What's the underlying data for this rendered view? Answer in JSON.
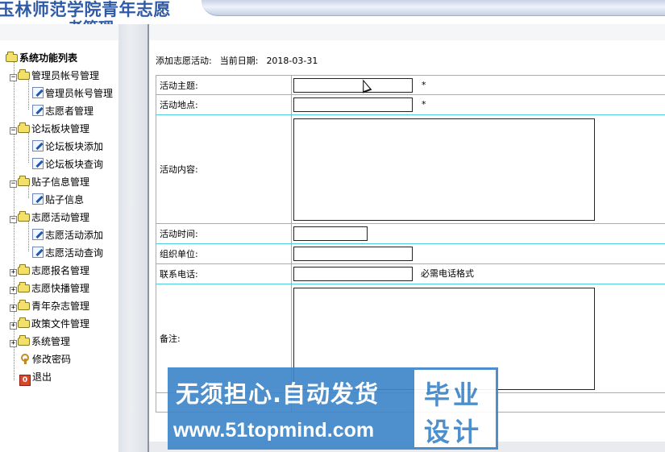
{
  "header": {
    "title": "玉林师范学院青年志愿",
    "title_line2": "者管理"
  },
  "sidebar": {
    "root_label": "系统功能列表",
    "groups": [
      {
        "label": "管理员帐号管理",
        "expanded": true,
        "items": [
          "管理员帐号管理",
          "志愿者管理"
        ]
      },
      {
        "label": "论坛板块管理",
        "expanded": true,
        "items": [
          "论坛板块添加",
          "论坛板块查询"
        ]
      },
      {
        "label": "贴子信息管理",
        "expanded": true,
        "items": [
          "贴子信息"
        ]
      },
      {
        "label": "志愿活动管理",
        "expanded": true,
        "items": [
          "志愿活动添加",
          "志愿活动查询"
        ]
      },
      {
        "label": "志愿报名管理",
        "expanded": false,
        "items": []
      },
      {
        "label": "志愿快播管理",
        "expanded": false,
        "items": []
      },
      {
        "label": "青年杂志管理",
        "expanded": false,
        "items": []
      },
      {
        "label": "政策文件管理",
        "expanded": false,
        "items": []
      },
      {
        "label": "系统管理",
        "expanded": false,
        "items": []
      }
    ],
    "change_password": "修改密码",
    "logout": "退出"
  },
  "breadcrumb": {
    "page": "添加志愿活动:",
    "date_label": "当前日期:",
    "date_value": "2018-03-31"
  },
  "form": {
    "subject_label": "活动主题:",
    "subject_value": "",
    "location_label": "活动地点:",
    "location_value": "",
    "content_label": "活动内容:",
    "content_value": "",
    "time_label": "活动时间:",
    "time_value": "",
    "org_label": "组织单位:",
    "org_value": "",
    "phone_label": "联系电话:",
    "phone_value": "",
    "phone_hint": "必需电话格式",
    "remark_label": "备注:",
    "remark_value": "",
    "required_mark": "*"
  },
  "watermark": {
    "line1": "无须担心.自动发货",
    "line2": "www.51topmind.com",
    "badge_top": "毕业",
    "badge_bottom": "设计"
  },
  "colors": {
    "table_border": "#4fd0dc",
    "title_blue": "#2e5aa8",
    "watermark_blue": "#3f87c9"
  }
}
